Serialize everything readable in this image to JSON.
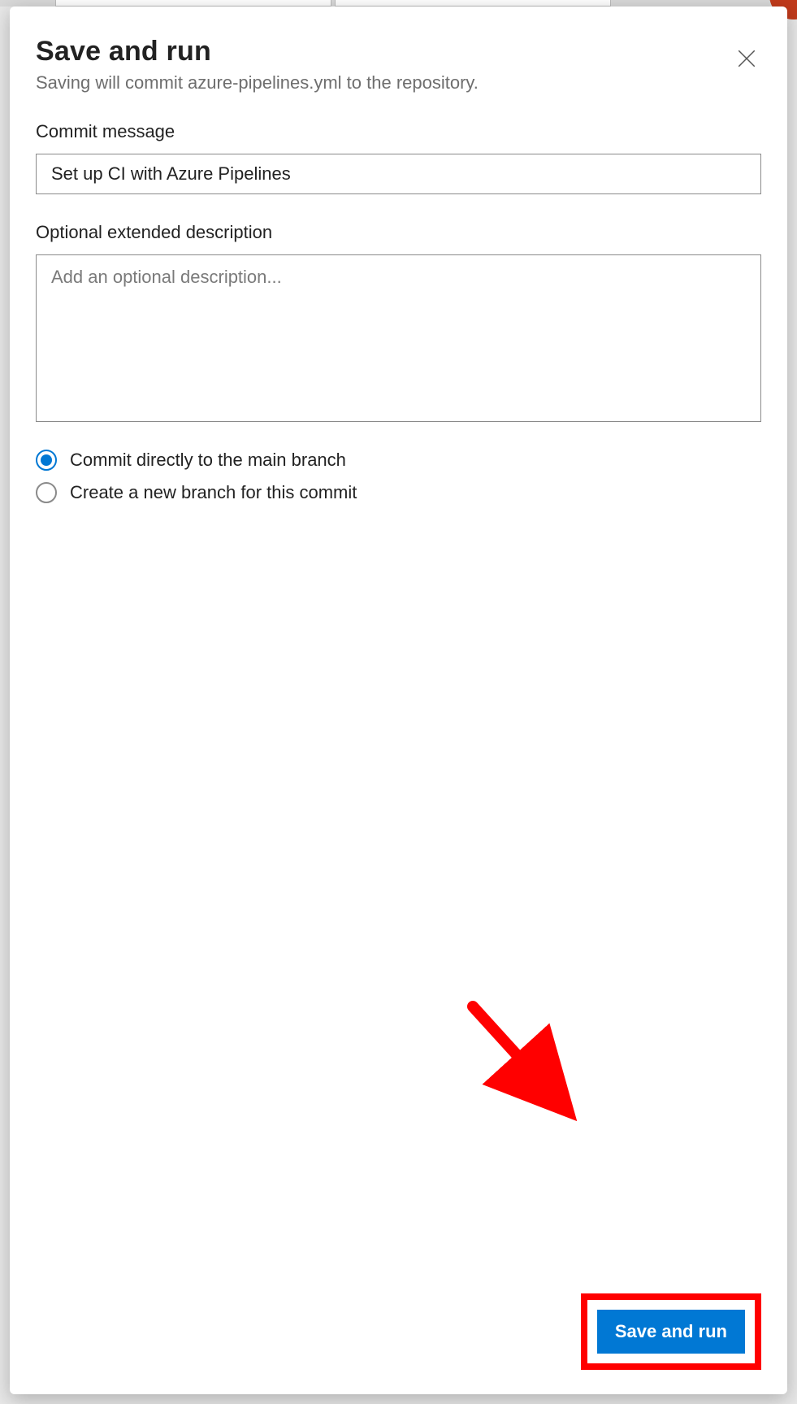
{
  "dialog": {
    "title": "Save and run",
    "subtitle": "Saving will commit azure-pipelines.yml to the repository."
  },
  "commit_message": {
    "label": "Commit message",
    "value": "Set up CI with Azure Pipelines"
  },
  "extended_description": {
    "label": "Optional extended description",
    "placeholder": "Add an optional description...",
    "value": ""
  },
  "branch_options": {
    "selected_index": 0,
    "options": [
      {
        "label": "Commit directly to the main branch"
      },
      {
        "label": "Create a new branch for this commit"
      }
    ]
  },
  "footer": {
    "save_label": "Save and run"
  },
  "colors": {
    "accent": "#0178d4",
    "annotation": "#ff0000"
  }
}
